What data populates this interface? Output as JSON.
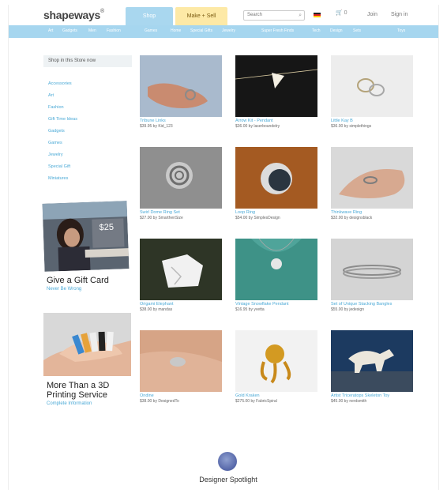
{
  "header": {
    "logo": "shapeways",
    "tab_shop": "Shop",
    "tab_make": "Make + Sell",
    "search_placeholder": "Search",
    "cart": "0",
    "links": [
      "Join",
      "Sign in"
    ]
  },
  "nav": {
    "items": [
      "Art",
      "Gadgets",
      "Men",
      "Fashion",
      "Games",
      "Home",
      "Special Gifts",
      "Jewelry",
      "Super Fresh Finds",
      "Tech",
      "Design",
      "Sets",
      "Toys"
    ]
  },
  "sidebar": {
    "heading": "Shop in this Store now",
    "categories": [
      "Accessories",
      "Art",
      "Fashion",
      "Gift Time Ideas",
      "Gadgets",
      "Games",
      "Jewelry",
      "Special Gift",
      "Miniatures"
    ],
    "gift": {
      "title": "Give a Gift Card",
      "link": "Never Be Wrong",
      "amount": "$25"
    },
    "print": {
      "title_line1": "More Than a 3D",
      "title_line2": "Printing Service",
      "link": "Complete Information"
    }
  },
  "products": [
    {
      "title": "Tribune Links",
      "byline": "$39.95 by Kid_123"
    },
    {
      "title": "Arrow Kit - Pendant",
      "byline": "$36.00 by laserboundelry"
    },
    {
      "title": "Little Kay B",
      "byline": "$36.00 by simplethings"
    },
    {
      "title": "Swirl Dome Ring Set",
      "byline": "$27.00 by SmarthenSize"
    },
    {
      "title": "Loop Ring",
      "byline": "$54.00 by SimplesDesign"
    },
    {
      "title": "Thinkwave Ring",
      "byline": "$32.00 by designsblack"
    },
    {
      "title": "Origami Elephant",
      "byline": "$38.00 by mandas"
    },
    {
      "title": "Vintage Snowflake Pendant",
      "byline": "$16.95 by yvetta"
    },
    {
      "title": "Set of Unique Stacking Bangles",
      "byline": "$55.00 by jedesign"
    },
    {
      "title": "Ondine",
      "byline": "$38.00 by DesignedTo"
    },
    {
      "title": "Gold Kraken",
      "byline": "$275.00 by FabricSpiral"
    },
    {
      "title": "Artist Triceratops Skeleton Toy",
      "byline": "$45.00 by nerdsmith"
    }
  ],
  "spotlight": {
    "label": "Designer Spotlight"
  },
  "colors": {
    "nav_bar": "#a6d6ef",
    "shop_tab": "#a9d7ef",
    "make_tab": "#fde9a6",
    "link": "#4aa9d6"
  }
}
